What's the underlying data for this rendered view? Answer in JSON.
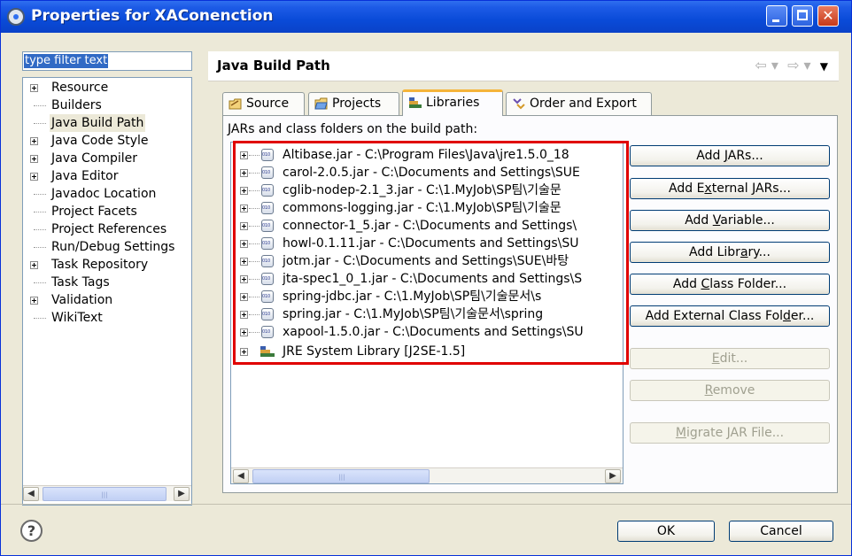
{
  "window": {
    "title": "Properties for XAConenction"
  },
  "filter": {
    "value": "type filter text"
  },
  "nav_tree": [
    {
      "label": "Resource",
      "expandable": true
    },
    {
      "label": "Builders",
      "expandable": false
    },
    {
      "label": "Java Build Path",
      "expandable": false,
      "selected": true
    },
    {
      "label": "Java Code Style",
      "expandable": true
    },
    {
      "label": "Java Compiler",
      "expandable": true
    },
    {
      "label": "Java Editor",
      "expandable": true
    },
    {
      "label": "Javadoc Location",
      "expandable": false
    },
    {
      "label": "Project Facets",
      "expandable": false
    },
    {
      "label": "Project References",
      "expandable": false
    },
    {
      "label": "Run/Debug Settings",
      "expandable": false
    },
    {
      "label": "Task Repository",
      "expandable": true
    },
    {
      "label": "Task Tags",
      "expandable": false
    },
    {
      "label": "Validation",
      "expandable": true
    },
    {
      "label": "WikiText",
      "expandable": false
    }
  ],
  "page": {
    "title": "Java Build Path"
  },
  "tabs": [
    {
      "label": "Source",
      "icon": "source-folder-icon"
    },
    {
      "label": "Projects",
      "icon": "projects-folder-icon"
    },
    {
      "label": "Libraries",
      "icon": "libraries-icon",
      "active": true
    },
    {
      "label": "Order and Export",
      "icon": "order-export-icon"
    }
  ],
  "libraries": {
    "caption": "JARs and class folders on the build path:",
    "items": [
      "Altibase.jar - C:\\Program Files\\Java\\jre1.5.0_18",
      "carol-2.0.5.jar - C:\\Documents and Settings\\SUE",
      "cglib-nodep-2.1_3.jar - C:\\1.MyJob\\SP팀\\기술문",
      "commons-logging.jar - C:\\1.MyJob\\SP팀\\기술문",
      "connector-1_5.jar - C:\\Documents and Settings\\",
      "howl-0.1.11.jar - C:\\Documents and Settings\\SU",
      "jotm.jar - C:\\Documents and Settings\\SUE\\바탕",
      "jta-spec1_0_1.jar - C:\\Documents and Settings\\S",
      "spring-jdbc.jar - C:\\1.MyJob\\SP팀\\기술문서\\s",
      "spring.jar - C:\\1.MyJob\\SP팀\\기술문서\\spring",
      "xapool-1.5.0.jar - C:\\Documents and Settings\\SU"
    ],
    "jre": "JRE System Library [J2SE-1.5]"
  },
  "buttons": {
    "add_jars": {
      "pre": "Add ",
      "u": "J",
      "post": "ARs..."
    },
    "add_external_jars": {
      "pre": "Add E",
      "u": "x",
      "post": "ternal JARs..."
    },
    "add_variable": {
      "pre": "Add ",
      "u": "V",
      "post": "ariable..."
    },
    "add_library": {
      "pre": "Add Libr",
      "u": "a",
      "post": "ry..."
    },
    "add_class_folder": {
      "pre": "Add ",
      "u": "C",
      "post": "lass Folder..."
    },
    "add_external_class_folder": {
      "pre": "Add External Class Fol",
      "u": "d",
      "post": "er..."
    },
    "edit": {
      "pre": "",
      "u": "E",
      "post": "dit..."
    },
    "remove": {
      "pre": "",
      "u": "R",
      "post": "emove"
    },
    "migrate": {
      "pre": "",
      "u": "M",
      "post": "igrate JAR File..."
    },
    "ok": "OK",
    "cancel": "Cancel"
  },
  "colors": {
    "title_bar": "#0a4bd8",
    "highlight_box": "#e00000",
    "active_tab_accent": "#f5b43a"
  }
}
